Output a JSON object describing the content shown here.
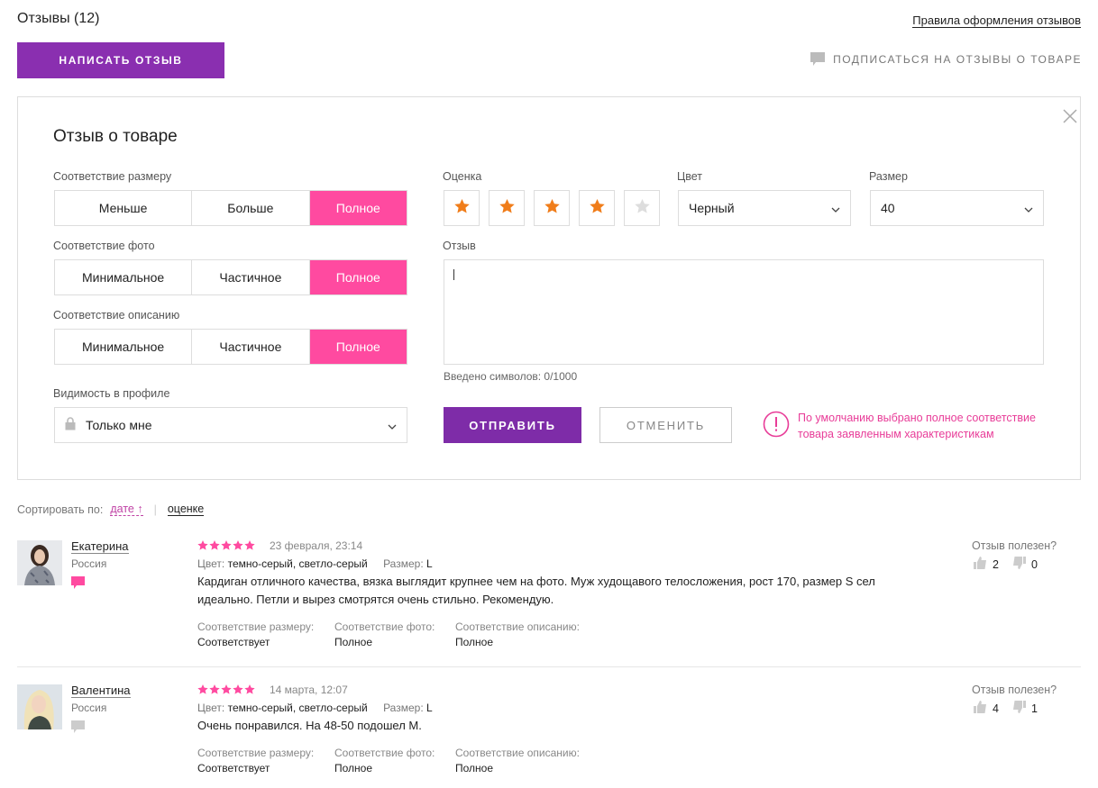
{
  "header": {
    "title": "Отзывы (12)",
    "rules_link": "Правила оформления отзывов",
    "write_button": "НАПИСАТЬ ОТЗЫВ",
    "subscribe": "ПОДПИСАТЬСЯ НА ОТЗЫВЫ О ТОВАРЕ"
  },
  "form": {
    "title": "Отзыв о товаре",
    "size_match": {
      "label": "Соответствие размеру",
      "options": [
        "Меньше",
        "Больше",
        "Полное"
      ],
      "selected": "Полное"
    },
    "photo_match": {
      "label": "Соответствие фото",
      "options": [
        "Минимальное",
        "Частичное",
        "Полное"
      ],
      "selected": "Полное"
    },
    "description_match": {
      "label": "Соответствие описанию",
      "options": [
        "Минимальное",
        "Частичное",
        "Полное"
      ],
      "selected": "Полное"
    },
    "visibility": {
      "label": "Видимость в профиле",
      "value": "Только мне"
    },
    "rating": {
      "label": "Оценка",
      "value": 4,
      "max": 5
    },
    "color": {
      "label": "Цвет",
      "value": "Черный"
    },
    "size": {
      "label": "Размер",
      "value": "40"
    },
    "review": {
      "label": "Отзыв",
      "value": "",
      "counter": "Введено символов: 0/1000"
    },
    "send_button": "ОТПРАВИТЬ",
    "cancel_button": "ОТМЕНИТЬ",
    "note": "По умолчанию выбрано полное соответствие товара заявленным характеристикам"
  },
  "sort": {
    "label": "Сортировать по:",
    "by_date": "дате",
    "date_arrow": "↑",
    "by_rating": "оценке"
  },
  "reviews": [
    {
      "name": "Екатерина",
      "country": "Россия",
      "stars": 5,
      "date": "23 февраля, 23:14",
      "color_label": "Цвет:",
      "color": "темно-серый, светло-серый",
      "size_label": "Размер:",
      "size": "L",
      "text": "Кардиган отличного качества, вязка выглядит крупнее чем на фото. Муж худощавого телосложения, рост 170, размер S сел идеально. Петли и вырез смотрятся очень стильно. Рекомендую.",
      "attr1_h": "Соответствие размеру:",
      "attr1_v": "Соответствует",
      "attr2_h": "Соответствие фото:",
      "attr2_v": "Полное",
      "attr3_h": "Соответствие описанию:",
      "attr3_v": "Полное",
      "helpful_label": "Отзыв полезен?",
      "likes": "2",
      "dislikes": "0",
      "comment_color": "#ff4aa0"
    },
    {
      "name": "Валентина",
      "country": "Россия",
      "stars": 5,
      "date": "14 марта, 12:07",
      "color_label": "Цвет:",
      "color": "темно-серый, светло-серый",
      "size_label": "Размер:",
      "size": "L",
      "text": "Очень понравился. На 48-50 подошел М.",
      "attr1_h": "Соответствие размеру:",
      "attr1_v": "Соответствует",
      "attr2_h": "Соответствие фото:",
      "attr2_v": "Полное",
      "attr3_h": "Соответствие описанию:",
      "attr3_v": "Полное",
      "helpful_label": "Отзыв полезен?",
      "likes": "4",
      "dislikes": "1",
      "comment_color": "#cccccc"
    }
  ],
  "colors": {
    "brand_purple": "#8a2fb0",
    "accent_pink": "#ff4aa0",
    "star_orange": "#f07d1a",
    "star_pink": "#ff4aa0"
  }
}
